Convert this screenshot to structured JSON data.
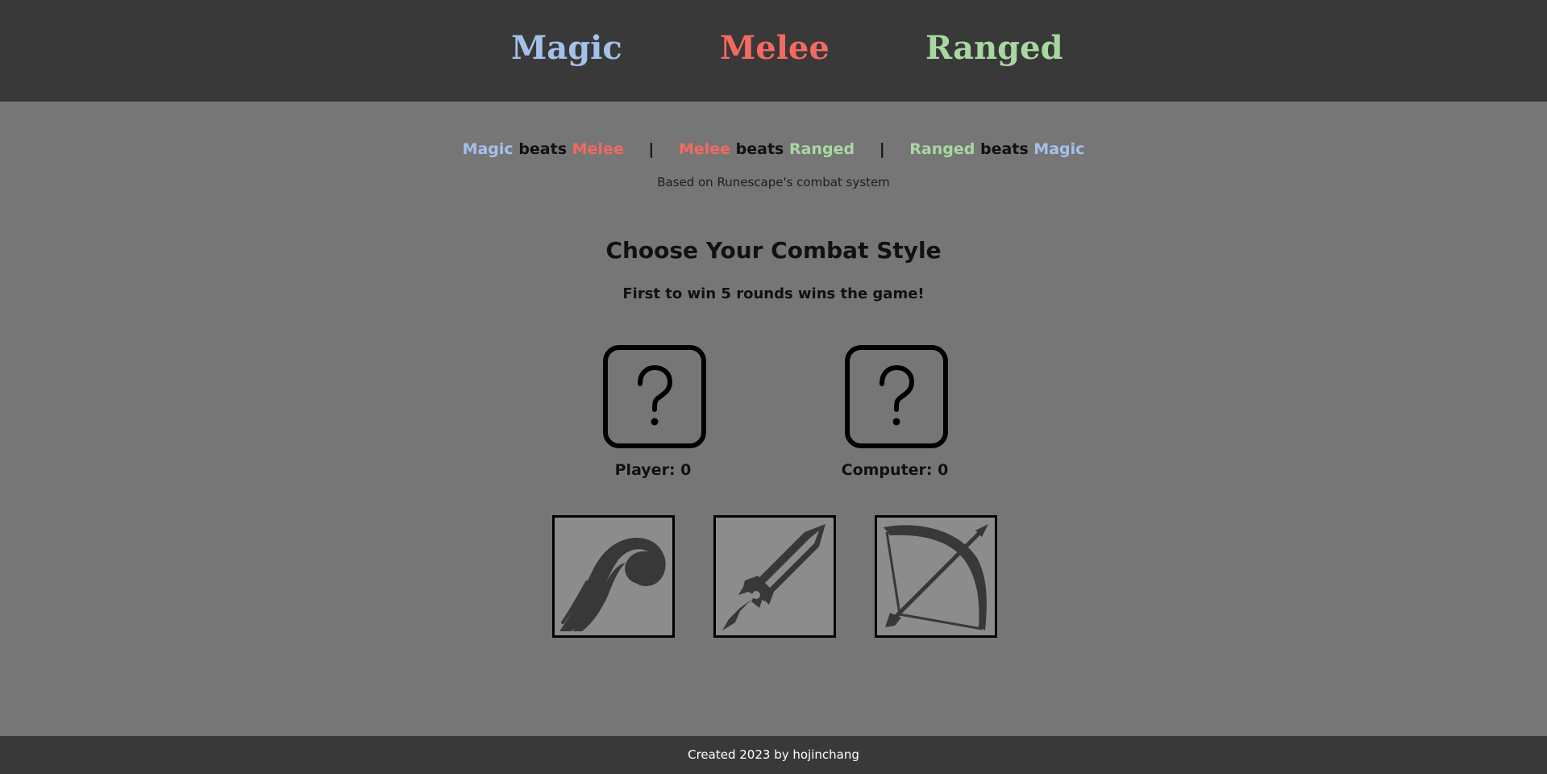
{
  "header": {
    "magic": "Magic",
    "melee": "Melee",
    "ranged": "Ranged"
  },
  "rules": [
    {
      "winner": "Magic",
      "verb": "beats",
      "loser": "Melee"
    },
    {
      "winner": "Melee",
      "verb": "beats",
      "loser": "Ranged"
    },
    {
      "winner": "Ranged",
      "verb": "beats",
      "loser": "Magic"
    }
  ],
  "separator": "|",
  "based_on": "Based on Runescape's combat system",
  "heading": "Choose Your Combat Style",
  "subheading": "First to win 5 rounds wins the game!",
  "player_choice": "?",
  "computer_choice": "?",
  "player_score_label": "Player: 0",
  "computer_score_label": "Computer: 0",
  "buttons": [
    {
      "name": "Magic",
      "icon": "magic-staff-icon"
    },
    {
      "name": "Melee",
      "icon": "sword-icon"
    },
    {
      "name": "Ranged",
      "icon": "bow-arrow-icon"
    }
  ],
  "footer": "Created 2023 by hojinchang",
  "colors": {
    "header_bg": "#393939",
    "page_bg": "#767676",
    "magic": "#a4c1ea",
    "melee": "#f26a61",
    "ranged": "#a9d7a1",
    "button_bg": "#8c8c8c",
    "icon_fill": "#383838"
  }
}
